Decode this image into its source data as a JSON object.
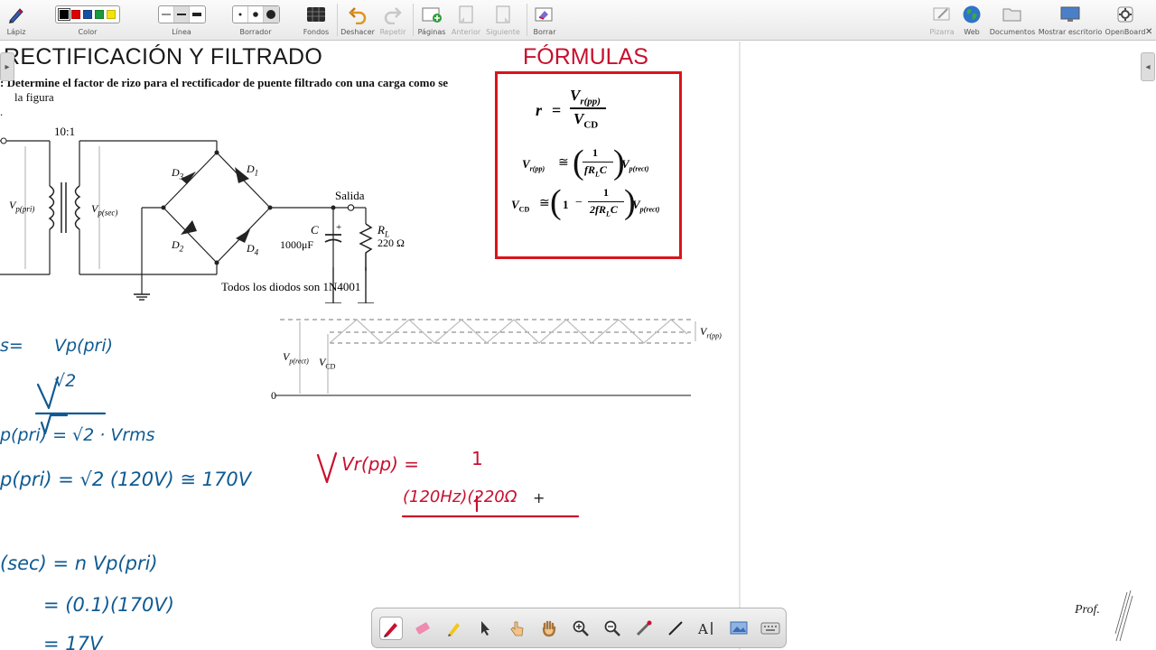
{
  "toolbar": {
    "pen": "Lápiz",
    "color": "Color",
    "line": "Línea",
    "eraser": "Borrador",
    "backgrounds": "Fondos",
    "undo": "Deshacer",
    "redo": "Repetir",
    "pages": "Páginas",
    "previous": "Anterior",
    "next": "Siguiente",
    "clear": "Borrar",
    "board": "Pizarra",
    "web": "Web",
    "documents": "Documentos",
    "show_desktop": "Mostrar escritorio",
    "openboard": "OpenBoard",
    "colors": [
      "#000000",
      "#e00000",
      "#1c4fa0",
      "#1a9a3a",
      "#f4e20c"
    ]
  },
  "page": {
    "title": "RECTIFICACIÓN Y FILTRADO",
    "problem_line1": ": Determine el factor de rizo para el rectificador de puente filtrado con una carga como se",
    "problem_line2": "la figura",
    "problem_marker": "."
  },
  "circuit": {
    "ratio": "10:1",
    "vp_pri": "V",
    "vp_pri_sub": "p(pri)",
    "vp_sec": "V",
    "vp_sec_sub": "p(sec)",
    "d1": "D",
    "d1_sub": "1",
    "d2": "D",
    "d2_sub": "2",
    "d3": "D",
    "d3_sub": "3",
    "d4": "D",
    "d4_sub": "4",
    "output": "Salida",
    "cap_name": "C",
    "cap_value": "1000μF",
    "cap_plus": "+",
    "load_name": "R",
    "load_sub": "L",
    "load_value": "220 Ω",
    "caption": "Todos los diodos son 1N4001"
  },
  "waveform": {
    "vp_rect": "V",
    "vp_rect_sub": "p(rect)",
    "vcd": "V",
    "vcd_sub": "CD",
    "vr_pp": "V",
    "vr_pp_sub": "r(pp)",
    "zero": "0"
  },
  "formulas": {
    "title": "FÓRMULAS",
    "r": "r",
    "eq": "=",
    "num": "V",
    "num_sub": "r(pp)",
    "den": "V",
    "den_sub": "CD",
    "f2_lhs": "V",
    "f2_lhs_sub": "r(pp)",
    "approx": "≅",
    "one": "1",
    "f2_den": "fR",
    "f2_den_sub": "L",
    "f2_den_c": "C",
    "f2_rhs": "V",
    "f2_rhs_sub": "p(rect)",
    "f3_lhs": "V",
    "f3_lhs_sub": "CD",
    "minus": "−",
    "f3_den": "2fR",
    "f3_den_sub": "L",
    "f3_den_c": "C",
    "f3_rhs": "V",
    "f3_rhs_sub": "p(rect)"
  },
  "handwriting": {
    "eq1_lhs": "s=",
    "eq1_num": "Vp(pri)",
    "eq1_den": "√2",
    "eq2": "p(pri) = √2 · Vrms",
    "eq3": "p(pri) = √2 (120V) ≅ 170V",
    "eq4": "(sec) = n Vp(pri)",
    "eq5": "= (0.1)(170V)",
    "eq6": "= 17V",
    "red_lhs": "Vr(pp) =",
    "red_num": "1",
    "red_den": "(120Hz)(220Ω"
  },
  "signature": "Prof."
}
